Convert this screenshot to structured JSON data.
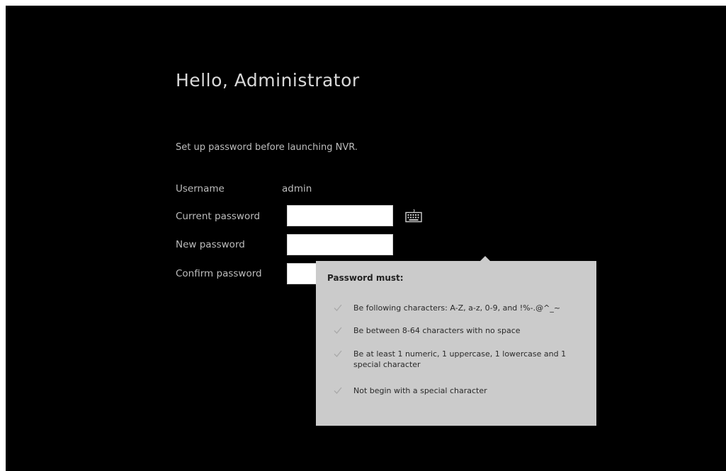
{
  "greeting": "Hello, Administrator",
  "subtitle": "Set up password before launching NVR.",
  "form": {
    "username_label": "Username",
    "username_value": "admin",
    "current_password_label": "Current password",
    "new_password_label": "New password",
    "confirm_password_label": "Confirm password",
    "current_password_value": "",
    "new_password_value": "",
    "confirm_password_value": ""
  },
  "keyboard_icon": "keyboard-icon",
  "tooltip": {
    "title": "Password must:",
    "rules": [
      "Be following characters: A-Z, a-z, 0-9, and !%-.@^_~",
      "Be between 8-64 characters with no space",
      "Be at least 1 numeric, 1 uppercase, 1 lowercase and 1 special character",
      "Not begin with a special character"
    ],
    "rule_icon": "check-icon"
  },
  "colors": {
    "background": "#000000",
    "text": "#bdbdbd",
    "tooltip_bg": "#cbcbcb",
    "check": "#a9a9a9"
  }
}
